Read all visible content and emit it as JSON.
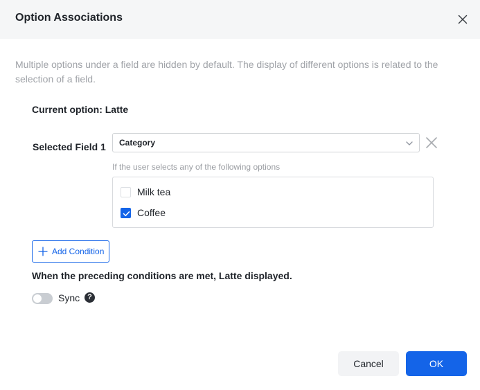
{
  "dialog": {
    "title": "Option Associations",
    "description": "Multiple options under a field are hidden by default. The display of different options is related to the selection of a field."
  },
  "current_option": "Current option: Latte",
  "condition": {
    "field_label": "Selected Field 1",
    "selected_field": "Category",
    "options_hint": "If the user selects any of the following options",
    "options": [
      {
        "label": "Milk tea",
        "checked": false
      },
      {
        "label": "Coffee",
        "checked": true
      }
    ]
  },
  "add_condition_label": "Add Condition",
  "result_text": "When the preceding conditions are met, Latte displayed.",
  "sync": {
    "label": "Sync",
    "enabled": false,
    "help_icon": "?"
  },
  "footer": {
    "cancel_label": "Cancel",
    "ok_label": "OK"
  },
  "colors": {
    "accent": "#1464e8",
    "header_bg": "#f5f6f7"
  },
  "icons": [
    "close-icon",
    "chevron-down-icon",
    "remove-icon",
    "check-icon",
    "plus-icon",
    "help-icon"
  ]
}
